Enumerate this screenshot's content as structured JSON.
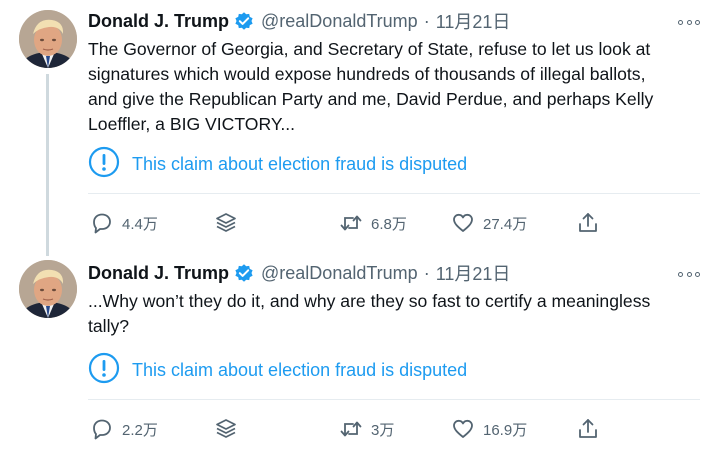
{
  "tweets": [
    {
      "author_name": "Donald J. Trump",
      "handle": "@realDonaldTrump",
      "separator": "·",
      "date": "11月21日",
      "text": "The Governor of Georgia, and Secretary of State, refuse to let us look at\nsignatures which would expose hundreds of thousands of illegal ballots,\nand give the Republican Party and me, David Perdue, and perhaps Kelly\nLoeffler, a BIG VICTORY...",
      "notice": "This claim about election fraud is disputed",
      "replies": "4.4万",
      "retweets": "6.8万",
      "likes": "27.4万"
    },
    {
      "author_name": "Donald J. Trump",
      "handle": "@realDonaldTrump",
      "separator": "·",
      "date": "11月21日",
      "text": "...Why won’t they do it, and why are they so fast to certify a meaningless\ntally?",
      "notice": "This claim about election fraud is disputed",
      "replies": "2.2万",
      "retweets": "3万",
      "likes": "16.9万"
    }
  ],
  "colors": {
    "accent": "#1d9bf0",
    "text": "#0f1419",
    "muted": "#536471",
    "divider": "#e6ecf0",
    "thread_line": "#cfd9de"
  },
  "icons": [
    "verified-badge-icon",
    "more-options-icon",
    "info-icon",
    "reply-icon",
    "stack-icon",
    "retweet-icon",
    "like-icon",
    "share-icon"
  ]
}
